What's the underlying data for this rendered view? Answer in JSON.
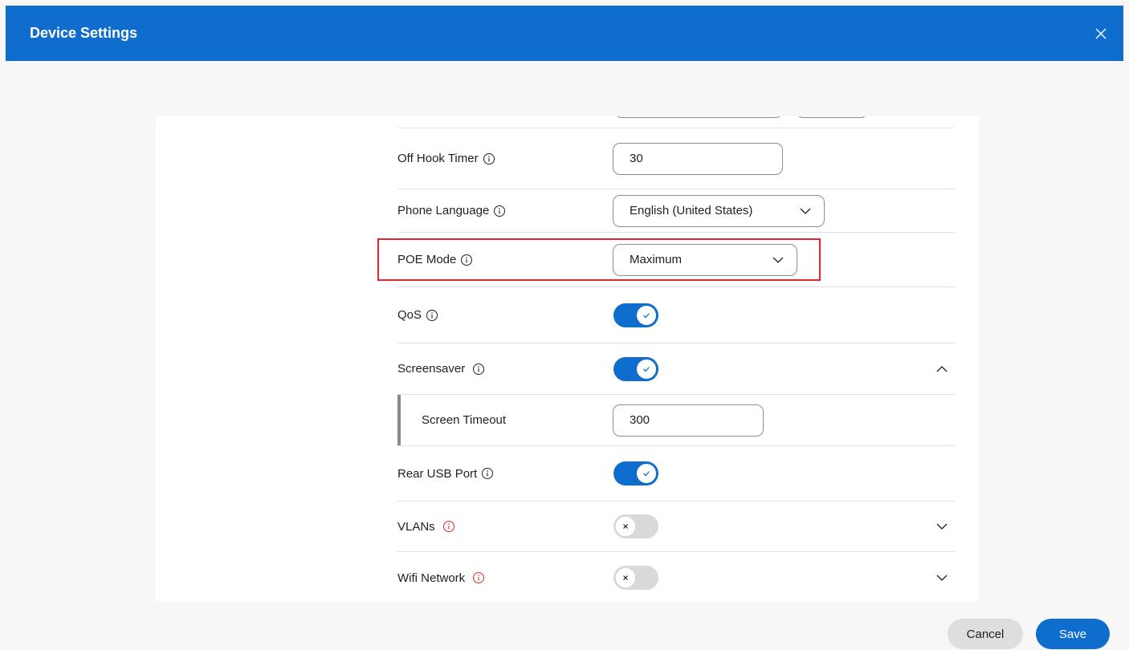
{
  "dialog": {
    "title": "Device Settings",
    "close_icon": "close-icon"
  },
  "settings": {
    "off_hook_timer": {
      "label": "Off Hook Timer",
      "value": "30"
    },
    "phone_language": {
      "label": "Phone Language",
      "value": "English (United States)"
    },
    "poe_mode": {
      "label": "POE Mode",
      "value": "Maximum"
    },
    "qos": {
      "label": "QoS",
      "enabled": true
    },
    "screensaver": {
      "label": "Screensaver",
      "enabled": true,
      "expanded": true
    },
    "screen_timeout": {
      "label": "Screen Timeout",
      "value": "300"
    },
    "rear_usb_port": {
      "label": "Rear USB Port",
      "enabled": true
    },
    "vlans": {
      "label": "VLANs",
      "enabled": false,
      "expanded": false
    },
    "wifi_network": {
      "label": "Wifi Network",
      "enabled": false,
      "expanded": false
    }
  },
  "footer": {
    "cancel_label": "Cancel",
    "save_label": "Save"
  },
  "colors": {
    "accent": "#0f6ecd",
    "highlight": "#e0262b",
    "warning_info": "#e0262b"
  }
}
